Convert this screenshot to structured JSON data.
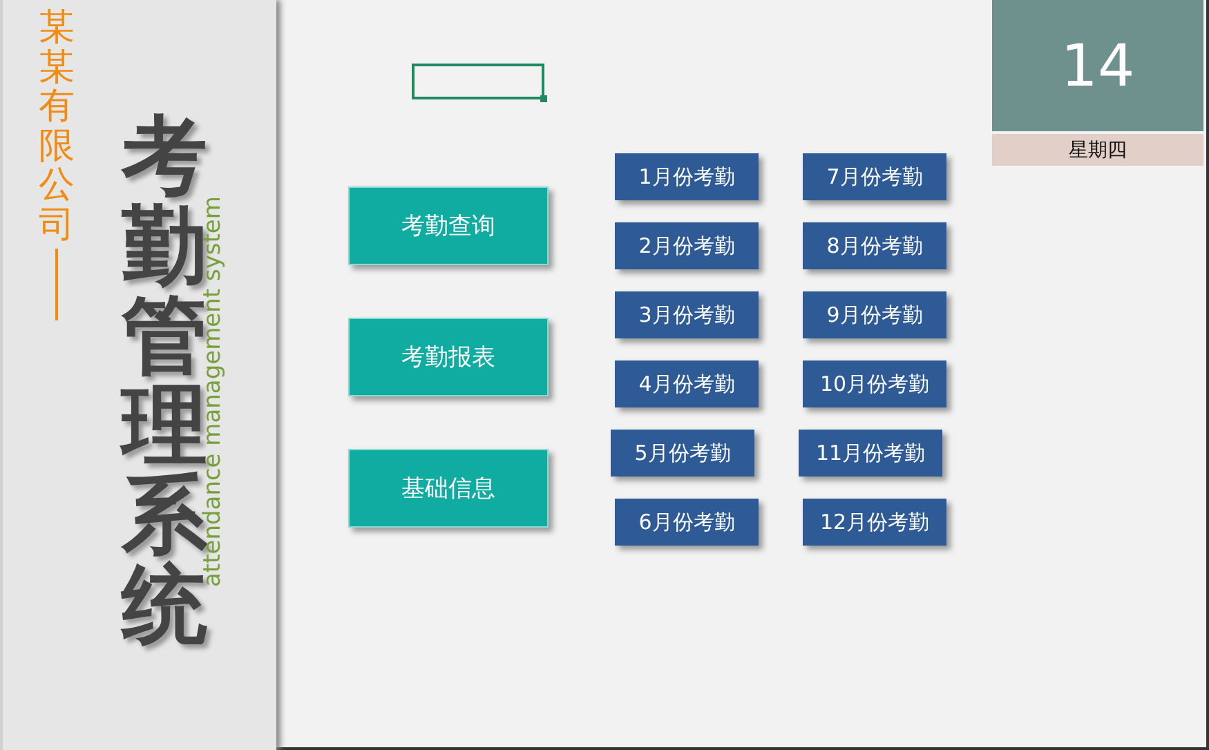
{
  "sidebar": {
    "company": "某某有限公司",
    "title": "考勤管理系统",
    "subtitle": "attendance management system"
  },
  "menu_buttons": [
    "考勤查询",
    "考勤报表",
    "基础信息"
  ],
  "month_buttons": [
    [
      "1月份考勤",
      "7月份考勤"
    ],
    [
      "2月份考勤",
      "8月份考勤"
    ],
    [
      "3月份考勤",
      "9月份考勤"
    ],
    [
      "4月份考勤",
      "10月份考勤"
    ],
    [
      "5月份考勤",
      "11月份考勤"
    ],
    [
      "6月份考勤",
      "12月份考勤"
    ]
  ],
  "date_card": {
    "day": "14",
    "weekday": "星期四"
  }
}
